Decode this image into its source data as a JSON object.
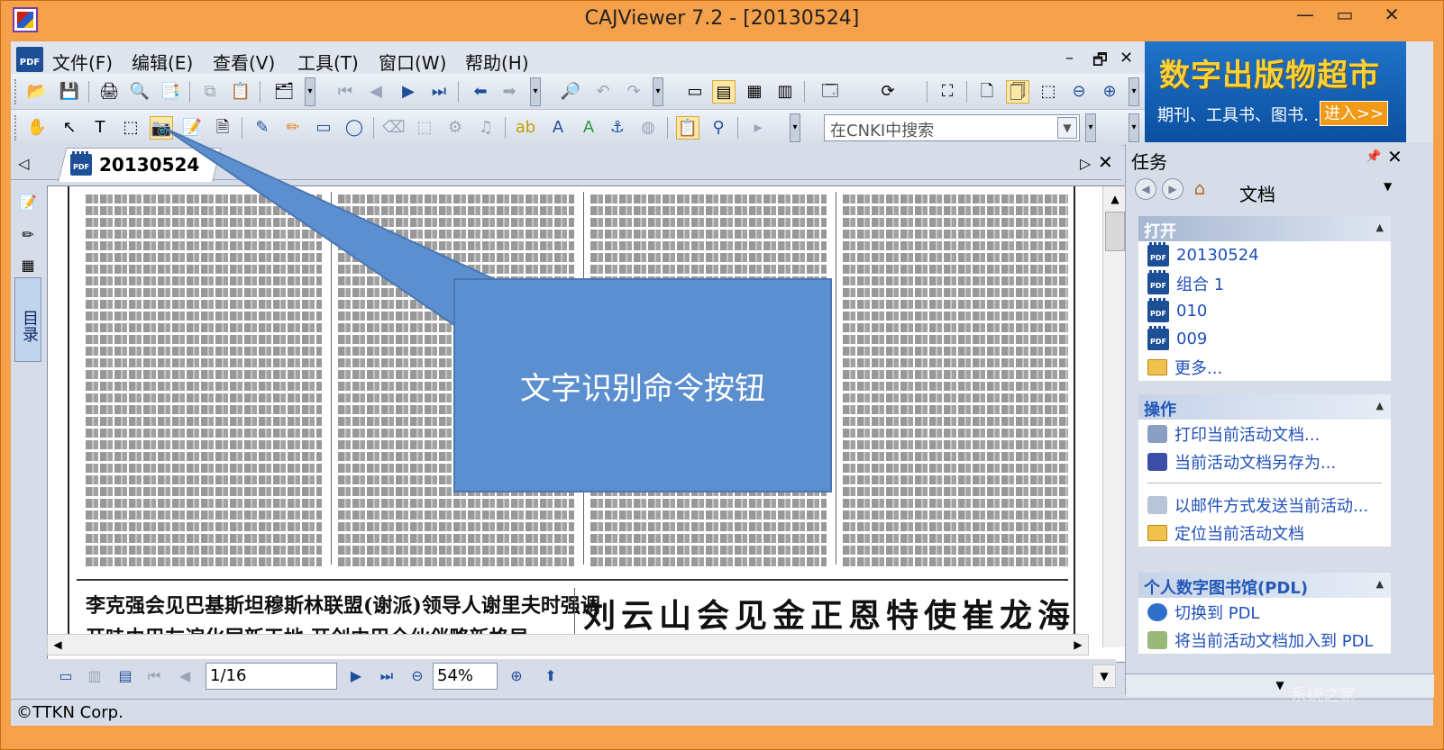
{
  "window": {
    "title": "CAJViewer 7.2 - [20130524]",
    "min": "—",
    "max": "▭",
    "close": "✕"
  },
  "menu": {
    "logo": "PDF",
    "items": [
      "文件(F)",
      "编辑(E)",
      "查看(V)",
      "工具(T)",
      "窗口(W)",
      "帮助(H)"
    ],
    "mdi_min": "–",
    "mdi_restore": "🗗",
    "mdi_close": "✕"
  },
  "search": {
    "placeholder": "在CNKI中搜索"
  },
  "ad": {
    "title": "数字出版物超市",
    "sub": "期刊、工具书、图书. . .",
    "button": "进入>>"
  },
  "doc_tab": {
    "label": "20130524",
    "icon_text": "PDF"
  },
  "sidebar": {
    "toc_label": "目录"
  },
  "newspaper": {
    "headline_left_1": "李克强会见巴基斯坦穆斯林联盟(谢派)领导人谢里夫时强调",
    "headline_left_2": "开哇由巴友谊化层新天地 开创由巴全伙伴略新格局",
    "headline_right": "刘云山会见金正恩特使崔龙海"
  },
  "nav": {
    "page": "1/16",
    "zoom": "54%"
  },
  "task_pane": {
    "title": "任务",
    "nav_label": "文档",
    "sections": {
      "open": {
        "title": "打开",
        "items": [
          "20130524",
          "组合 1",
          "010",
          "009"
        ],
        "more": "更多..."
      },
      "ops": {
        "title": "操作",
        "items": [
          "打印当前活动文档...",
          "当前活动文档另存为...",
          "以邮件方式发送当前活动...",
          "定位当前活动文档"
        ]
      },
      "pdl": {
        "title": "个人数字图书馆(PDL)",
        "items": [
          "切换到 PDL",
          "将当前活动文档加入到 PDL"
        ]
      }
    }
  },
  "status": {
    "text": "©TTKN Corp."
  },
  "callout": {
    "text": "文字识别命令按钮",
    "color": "#5b8fd0"
  },
  "watermark": "系统之家"
}
